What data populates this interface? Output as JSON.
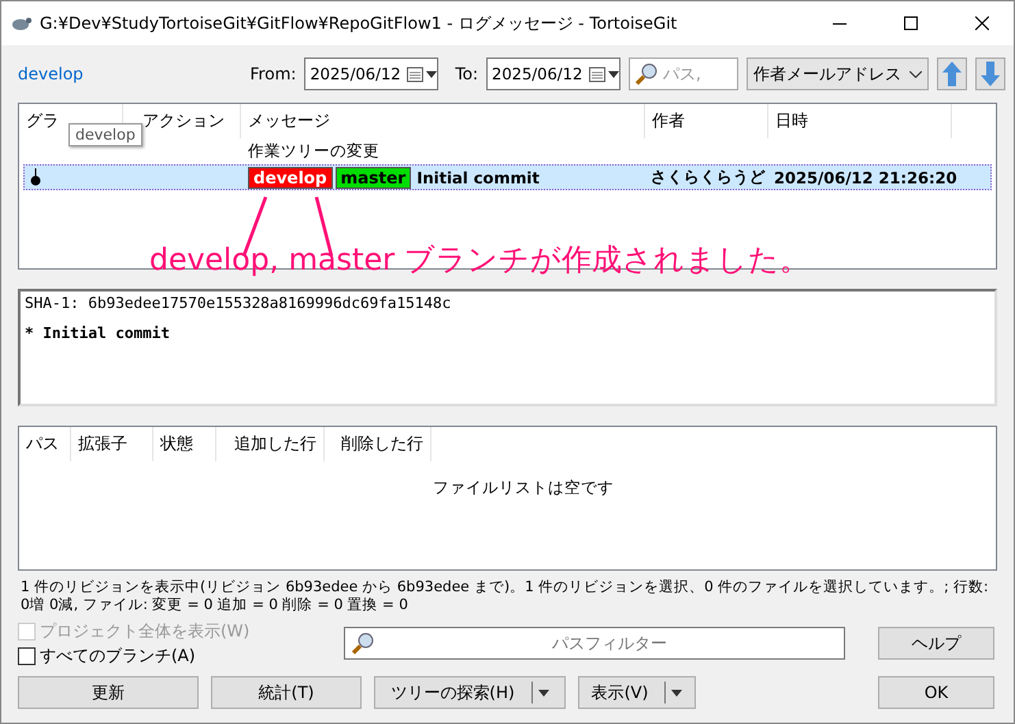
{
  "window": {
    "title": "G:¥Dev¥StudyTortoiseGit¥GitFlow¥RepoGitFlow1 - ログメッセージ - TortoiseGit"
  },
  "toolbar": {
    "branch": "develop",
    "from_label": "From:",
    "from_date": "2025/06/12",
    "to_label": "To:",
    "to_date": "2025/06/12",
    "search_placeholder": "パス,",
    "filter_field": "作者メールアドレス"
  },
  "log": {
    "columns": [
      "グラ",
      "アクション",
      "メッセージ",
      "作者",
      "日時"
    ],
    "tooltip": "develop",
    "rows": [
      {
        "kind": "working_tree",
        "message": "作業ツリーの変更",
        "selected": false
      },
      {
        "kind": "commit",
        "refs": [
          {
            "name": "develop",
            "color": "#ff0000"
          },
          {
            "name": "master",
            "color": "#00dd00"
          }
        ],
        "message": "Initial commit",
        "author": "さくらくらうど",
        "date": "2025/06/12 21:26:20",
        "selected": true
      }
    ]
  },
  "annotation": "develop, master ブランチが作成されました。",
  "details": {
    "sha_line": "SHA-1: 6b93edee17570e1553",
    "sha_rest": "28a8169996dc69fa15148c",
    "message": "* Initial commit"
  },
  "files": {
    "columns": [
      "パス",
      "拡張子",
      "状態",
      "追加した行",
      "削除した行"
    ],
    "empty_text": "ファイルリストは空です"
  },
  "status_bar": "1 件のリビジョンを表示中(リビジョン 6b93edee から 6b93edee まで)。1 件のリビジョンを選択、0 件のファイルを選択しています。; 行数: 0増 0減, ファイル: 変更 = 0 追加 = 0 削除 = 0 置換 = 0",
  "checkboxes": [
    {
      "label": "プロジェクト全体を表示(W)",
      "checked": false,
      "disabled": true
    },
    {
      "label": "すべてのブランチ(A)",
      "checked": false,
      "disabled": false
    }
  ],
  "path_filter": {
    "placeholder": "パスフィルター"
  },
  "buttons": {
    "help": "ヘルプ",
    "refresh": "更新",
    "stats": "統計(T)",
    "browse": "ツリーの探索(H)",
    "view": "表示(V)",
    "ok": "OK"
  }
}
